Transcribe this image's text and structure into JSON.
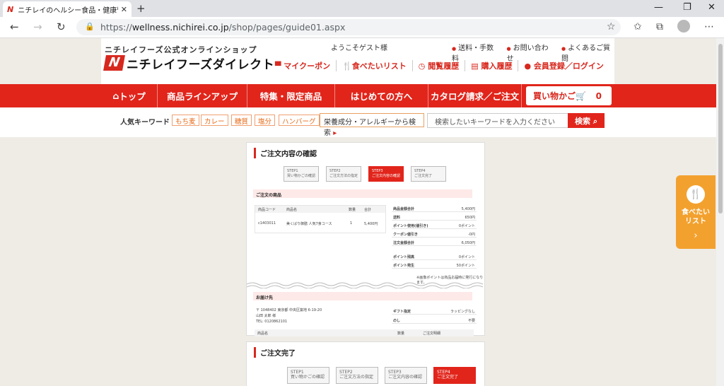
{
  "browser": {
    "tab_title": "ニチレイのヘルシー食品・健康管理食",
    "url_prefix": "https://",
    "url_host": "wellness.nichirei.co.jp",
    "url_path": "/shop/pages/guide01.aspx",
    "favicon": "N"
  },
  "header": {
    "subtitle": "ニチレイフーズ公式オンラインショップ",
    "logo_text": "ニチレイフーズダイレクト",
    "welcome": "ようこそゲスト様",
    "top_links": [
      "送料・手数料",
      "お問い合わせ",
      "よくあるご質問"
    ],
    "nav_links": [
      "マイクーポン",
      "食べたいリスト",
      "閲覧履歴",
      "購入履歴",
      "会員登録／ログイン"
    ]
  },
  "navbar": {
    "items": [
      "トップ",
      "商品ラインアップ",
      "特集・限定商品",
      "はじめての方へ",
      "カタログ請求／ご注文"
    ],
    "cart_label": "買い物かご",
    "cart_count": "0"
  },
  "keywords": {
    "label": "人気キーワード",
    "items": [
      "もち麦",
      "カレー",
      "糖質",
      "塩分",
      "ハンバーグ"
    ],
    "allergy": "栄養成分・アレルギーから検索",
    "search_placeholder": "検索したいキーワードを入力ください",
    "search_button": "検索"
  },
  "guide1": {
    "title": "ご注文内容の確認",
    "steps": [
      [
        "STEP1",
        "買い物かごの確認"
      ],
      [
        "STEP2",
        "ご注文方法の指定"
      ],
      [
        "STEP3",
        "ご注文内容の確認"
      ],
      [
        "STEP4",
        "ご注文完了"
      ]
    ],
    "section1": "ご注文の商品",
    "headers": [
      "商品コード",
      "商品名",
      "数量",
      "合計"
    ],
    "item": [
      "c1403011",
      "美くばり御膳 人気7食コース",
      "1",
      "5,400円"
    ],
    "summary": [
      [
        "商品金額合計",
        "5,400円"
      ],
      [
        "送料",
        "650円"
      ],
      [
        "ポイント使用(値引き)",
        "0ポイント"
      ],
      [
        "クーポン値引き",
        "-0円"
      ],
      [
        "注文金額合計",
        "6,050円"
      ],
      [
        "ポイント残高",
        "0ポイント"
      ],
      [
        "ポイント発生",
        "50ポイント"
      ]
    ],
    "note": "※画像ポイントは商品お届時に発行になります。",
    "section2": "お届け先",
    "address": [
      "〒 1048402 東京都 中央区築地 6-19-20",
      "山田 太郎 様",
      "TEL: 0120862101"
    ],
    "gift": [
      [
        "ギフト指定",
        "ラッピングなし"
      ],
      [
        "のし",
        "不要"
      ]
    ],
    "footer_cols": [
      "商品名",
      "数量",
      "ご注文明細"
    ]
  },
  "guide2": {
    "title": "ご注文完了",
    "steps": [
      [
        "STEP1",
        "買い物かごの確認"
      ],
      [
        "STEP2",
        "ご注文方法の指定"
      ],
      [
        "STEP3",
        "ご注文内容の確認"
      ],
      [
        "STEP4",
        "ご注文完了"
      ]
    ]
  },
  "float": {
    "label1": "食べたい",
    "label2": "リスト",
    "arrow": "›"
  },
  "colors": {
    "brand_red": "#e1251b",
    "orange": "#f3a12e"
  }
}
